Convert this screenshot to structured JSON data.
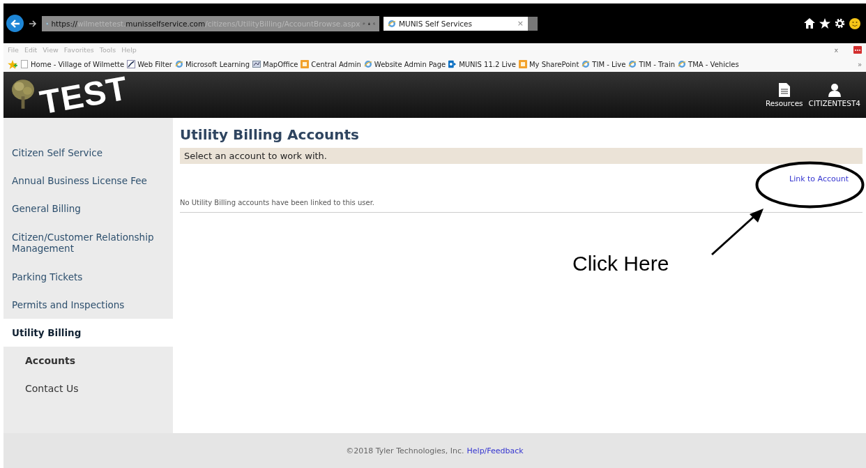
{
  "browser": {
    "url_parts": [
      {
        "text": "https://",
        "dim": false
      },
      {
        "text": "wilmettetest.",
        "dim": true
      },
      {
        "text": "munisselfservice.com",
        "dim": false
      },
      {
        "text": "/citizens/UtilityBilling/AccountBrowse.aspx",
        "dim": true
      }
    ],
    "tab": {
      "title": "MUNIS Self Services",
      "close": "×"
    },
    "close": "x",
    "menu": [
      "File",
      "Edit",
      "View",
      "Favorites",
      "Tools",
      "Help"
    ],
    "favorites": [
      {
        "label": "Home - Village of Wilmette",
        "kind": "page"
      },
      {
        "label": "Web Filter",
        "kind": "filter"
      },
      {
        "label": "Microsoft Learning",
        "kind": "ie"
      },
      {
        "label": "MapOffice",
        "kind": "map"
      },
      {
        "label": "Central Admin",
        "kind": "orange"
      },
      {
        "label": "Website Admin Page",
        "kind": "ie"
      },
      {
        "label": "MUNIS 11.2 Live",
        "kind": "sharepoint"
      },
      {
        "label": "My SharePoint",
        "kind": "orange"
      },
      {
        "label": "TIM - Live",
        "kind": "ie"
      },
      {
        "label": "TIM - Train",
        "kind": "ie"
      },
      {
        "label": "TMA - Vehicles",
        "kind": "ie"
      }
    ],
    "more": "»"
  },
  "header": {
    "logo_stamp": "TEST",
    "resources": "Resources",
    "user": "CITIZENTEST4"
  },
  "sidebar": [
    {
      "label": "Citizen Self Service",
      "selected": false
    },
    {
      "label": "Annual Business License Fee",
      "selected": false
    },
    {
      "label": "General Billing",
      "selected": false
    },
    {
      "label": "Citizen/Customer Relationship Management",
      "selected": false
    },
    {
      "label": "Parking Tickets",
      "selected": false
    },
    {
      "label": "Permits and Inspections",
      "selected": false
    },
    {
      "label": "Utility Billing",
      "selected": true,
      "children": [
        {
          "label": "Accounts",
          "selected": true
        },
        {
          "label": "Contact Us",
          "selected": false
        }
      ]
    }
  ],
  "main": {
    "title": "Utility Billing Accounts",
    "instruction": "Select an account to work with.",
    "link": "Link to Account",
    "empty_message": "No Utility Billing accounts have been linked to this user."
  },
  "annotation": {
    "text": "Click Here"
  },
  "footer": {
    "copyright": "©2018 Tyler Technologies, Inc.",
    "link": "Help/Feedback"
  }
}
